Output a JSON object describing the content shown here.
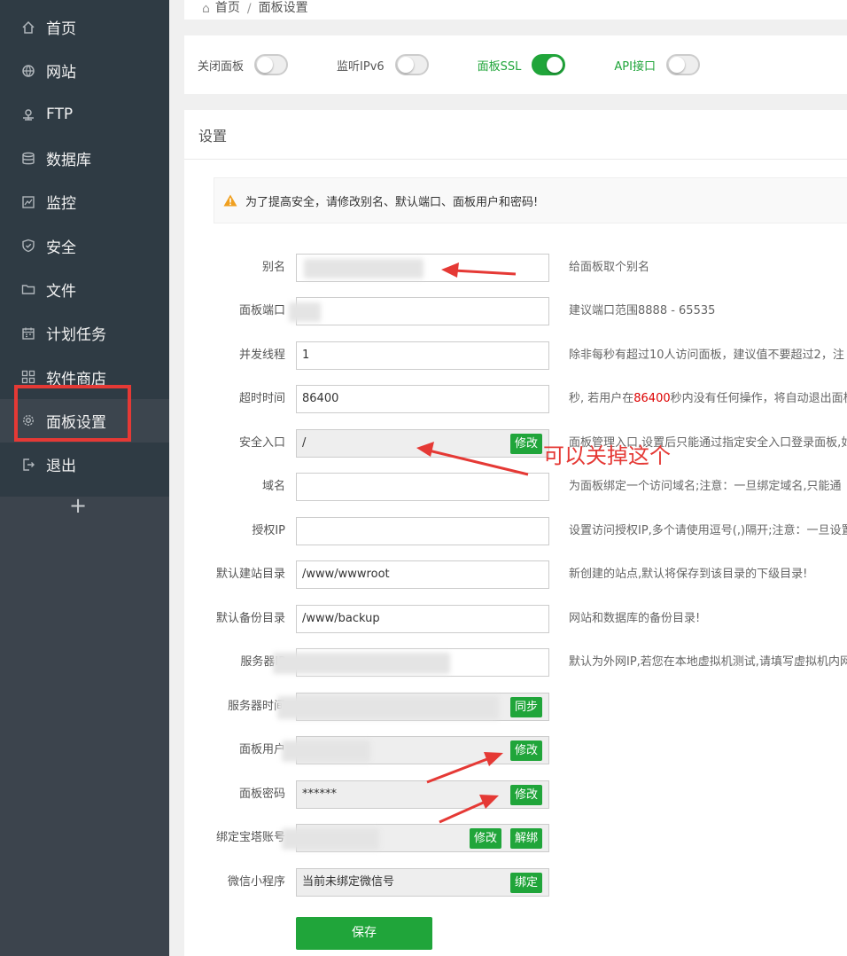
{
  "sidebar": {
    "items": [
      {
        "label": "首页",
        "icon": "home-icon"
      },
      {
        "label": "网站",
        "icon": "globe-icon"
      },
      {
        "label": "FTP",
        "icon": "ftp-icon"
      },
      {
        "label": "数据库",
        "icon": "database-icon"
      },
      {
        "label": "监控",
        "icon": "monitor-icon"
      },
      {
        "label": "安全",
        "icon": "shield-icon"
      },
      {
        "label": "文件",
        "icon": "folder-icon"
      },
      {
        "label": "计划任务",
        "icon": "calendar-icon"
      },
      {
        "label": "软件商店",
        "icon": "apps-icon"
      },
      {
        "label": "面板设置",
        "icon": "gear-icon"
      },
      {
        "label": "退出",
        "icon": "logout-icon"
      }
    ],
    "add_label": "+"
  },
  "breadcrumb": {
    "home": "首页",
    "sep": "/",
    "current": "面板设置"
  },
  "toggles": [
    {
      "label": "关闭面板",
      "on": false
    },
    {
      "label": "监听IPv6",
      "on": false
    },
    {
      "label": "面板SSL",
      "on": true
    },
    {
      "label": "API接口",
      "on": false
    }
  ],
  "settings": {
    "title": "设置",
    "alert": "为了提高安全，请修改别名、默认端口、面板用户和密码!",
    "rows": [
      {
        "label": "别名",
        "value": "",
        "hint": "给面板取个别名"
      },
      {
        "label": "面板端口",
        "value": "",
        "hint": "建议端口范围8888 - 65535"
      },
      {
        "label": "并发线程",
        "value": "1",
        "hint": "除非每秒有超过10人访问面板，建议值不要超过2，注"
      },
      {
        "label": "超时时间",
        "value": "86400",
        "hint_pre": "秒, 若用户在",
        "hint_red": "86400",
        "hint_post": "秒内没有任何操作，将自动退出面板"
      },
      {
        "label": "安全入口",
        "value": "/",
        "button": "修改",
        "hint": "面板管理入口,设置后只能通过指定安全入口登录面板,如"
      },
      {
        "label": "域名",
        "value": "",
        "hint": "为面板绑定一个访问域名;注意：一旦绑定域名,只能通"
      },
      {
        "label": "授权IP",
        "value": "",
        "hint": "设置访问授权IP,多个请使用逗号(,)隔开;注意：一旦设置"
      },
      {
        "label": "默认建站目录",
        "value": "/www/wwwroot",
        "hint": "新创建的站点,默认将保存到该目录的下级目录!"
      },
      {
        "label": "默认备份目录",
        "value": "/www/backup",
        "hint": "网站和数据库的备份目录!"
      },
      {
        "label": "服务器IP",
        "value": "",
        "hint": "默认为外网IP,若您在本地虚拟机测试,请填写虚拟机内网"
      },
      {
        "label": "服务器时间",
        "value": "",
        "button": "同步",
        "hint": ""
      },
      {
        "label": "面板用户",
        "value": "",
        "button": "修改",
        "hint": ""
      },
      {
        "label": "面板密码",
        "value": "******",
        "button": "修改",
        "hint": ""
      },
      {
        "label": "绑定宝塔账号",
        "value": "",
        "button": "修改",
        "button2": "解绑",
        "hint": ""
      },
      {
        "label": "微信小程序",
        "value": "当前未绑定微信号",
        "button": "绑定",
        "hint": ""
      }
    ],
    "save_label": "保存"
  },
  "annotation": {
    "text": "可以关掉这个",
    "color": "#e53935"
  },
  "colors": {
    "sidebar_bg": "#3c444d",
    "accent_green": "#20a53a",
    "annotation_red": "#e53935"
  }
}
